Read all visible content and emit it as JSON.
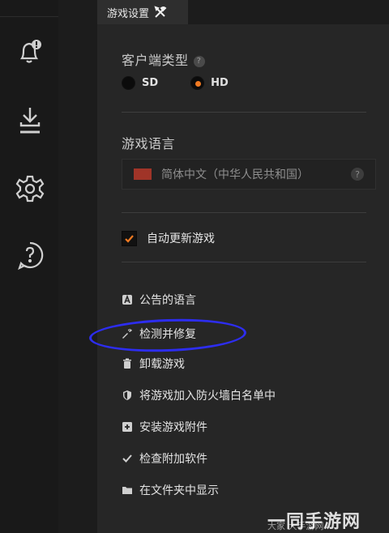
{
  "tab": {
    "label": "游戏设置"
  },
  "client_type": {
    "label": "客户端类型",
    "help": "?",
    "options": [
      {
        "label": "SD",
        "selected": false
      },
      {
        "label": "HD",
        "selected": true
      }
    ]
  },
  "game_language": {
    "label": "游戏语言",
    "value": "简体中文（中华人民共和国）",
    "help": "?"
  },
  "auto_update": {
    "label": "自动更新游戏",
    "checked": true
  },
  "actions": [
    {
      "icon": "a-letter-icon",
      "label": "公告的语言"
    },
    {
      "icon": "wrench-icon",
      "label": "检测并修复"
    },
    {
      "icon": "trash-icon",
      "label": "卸载游戏"
    },
    {
      "icon": "shield-icon",
      "label": "将游戏加入防火墙白名单中"
    },
    {
      "icon": "plus-box-icon",
      "label": "安装游戏附件"
    },
    {
      "icon": "check-icon",
      "label": "检查附加软件"
    },
    {
      "icon": "folder-icon",
      "label": "在文件夹中显示"
    }
  ],
  "rail": [
    "notification-icon",
    "download-icon",
    "settings-icon",
    "help-icon"
  ],
  "watermark": {
    "main": "一同手游网",
    "sub": "大家 大手游网"
  },
  "colors": {
    "accent": "#f07a22",
    "annotation": "#2d2df0"
  }
}
